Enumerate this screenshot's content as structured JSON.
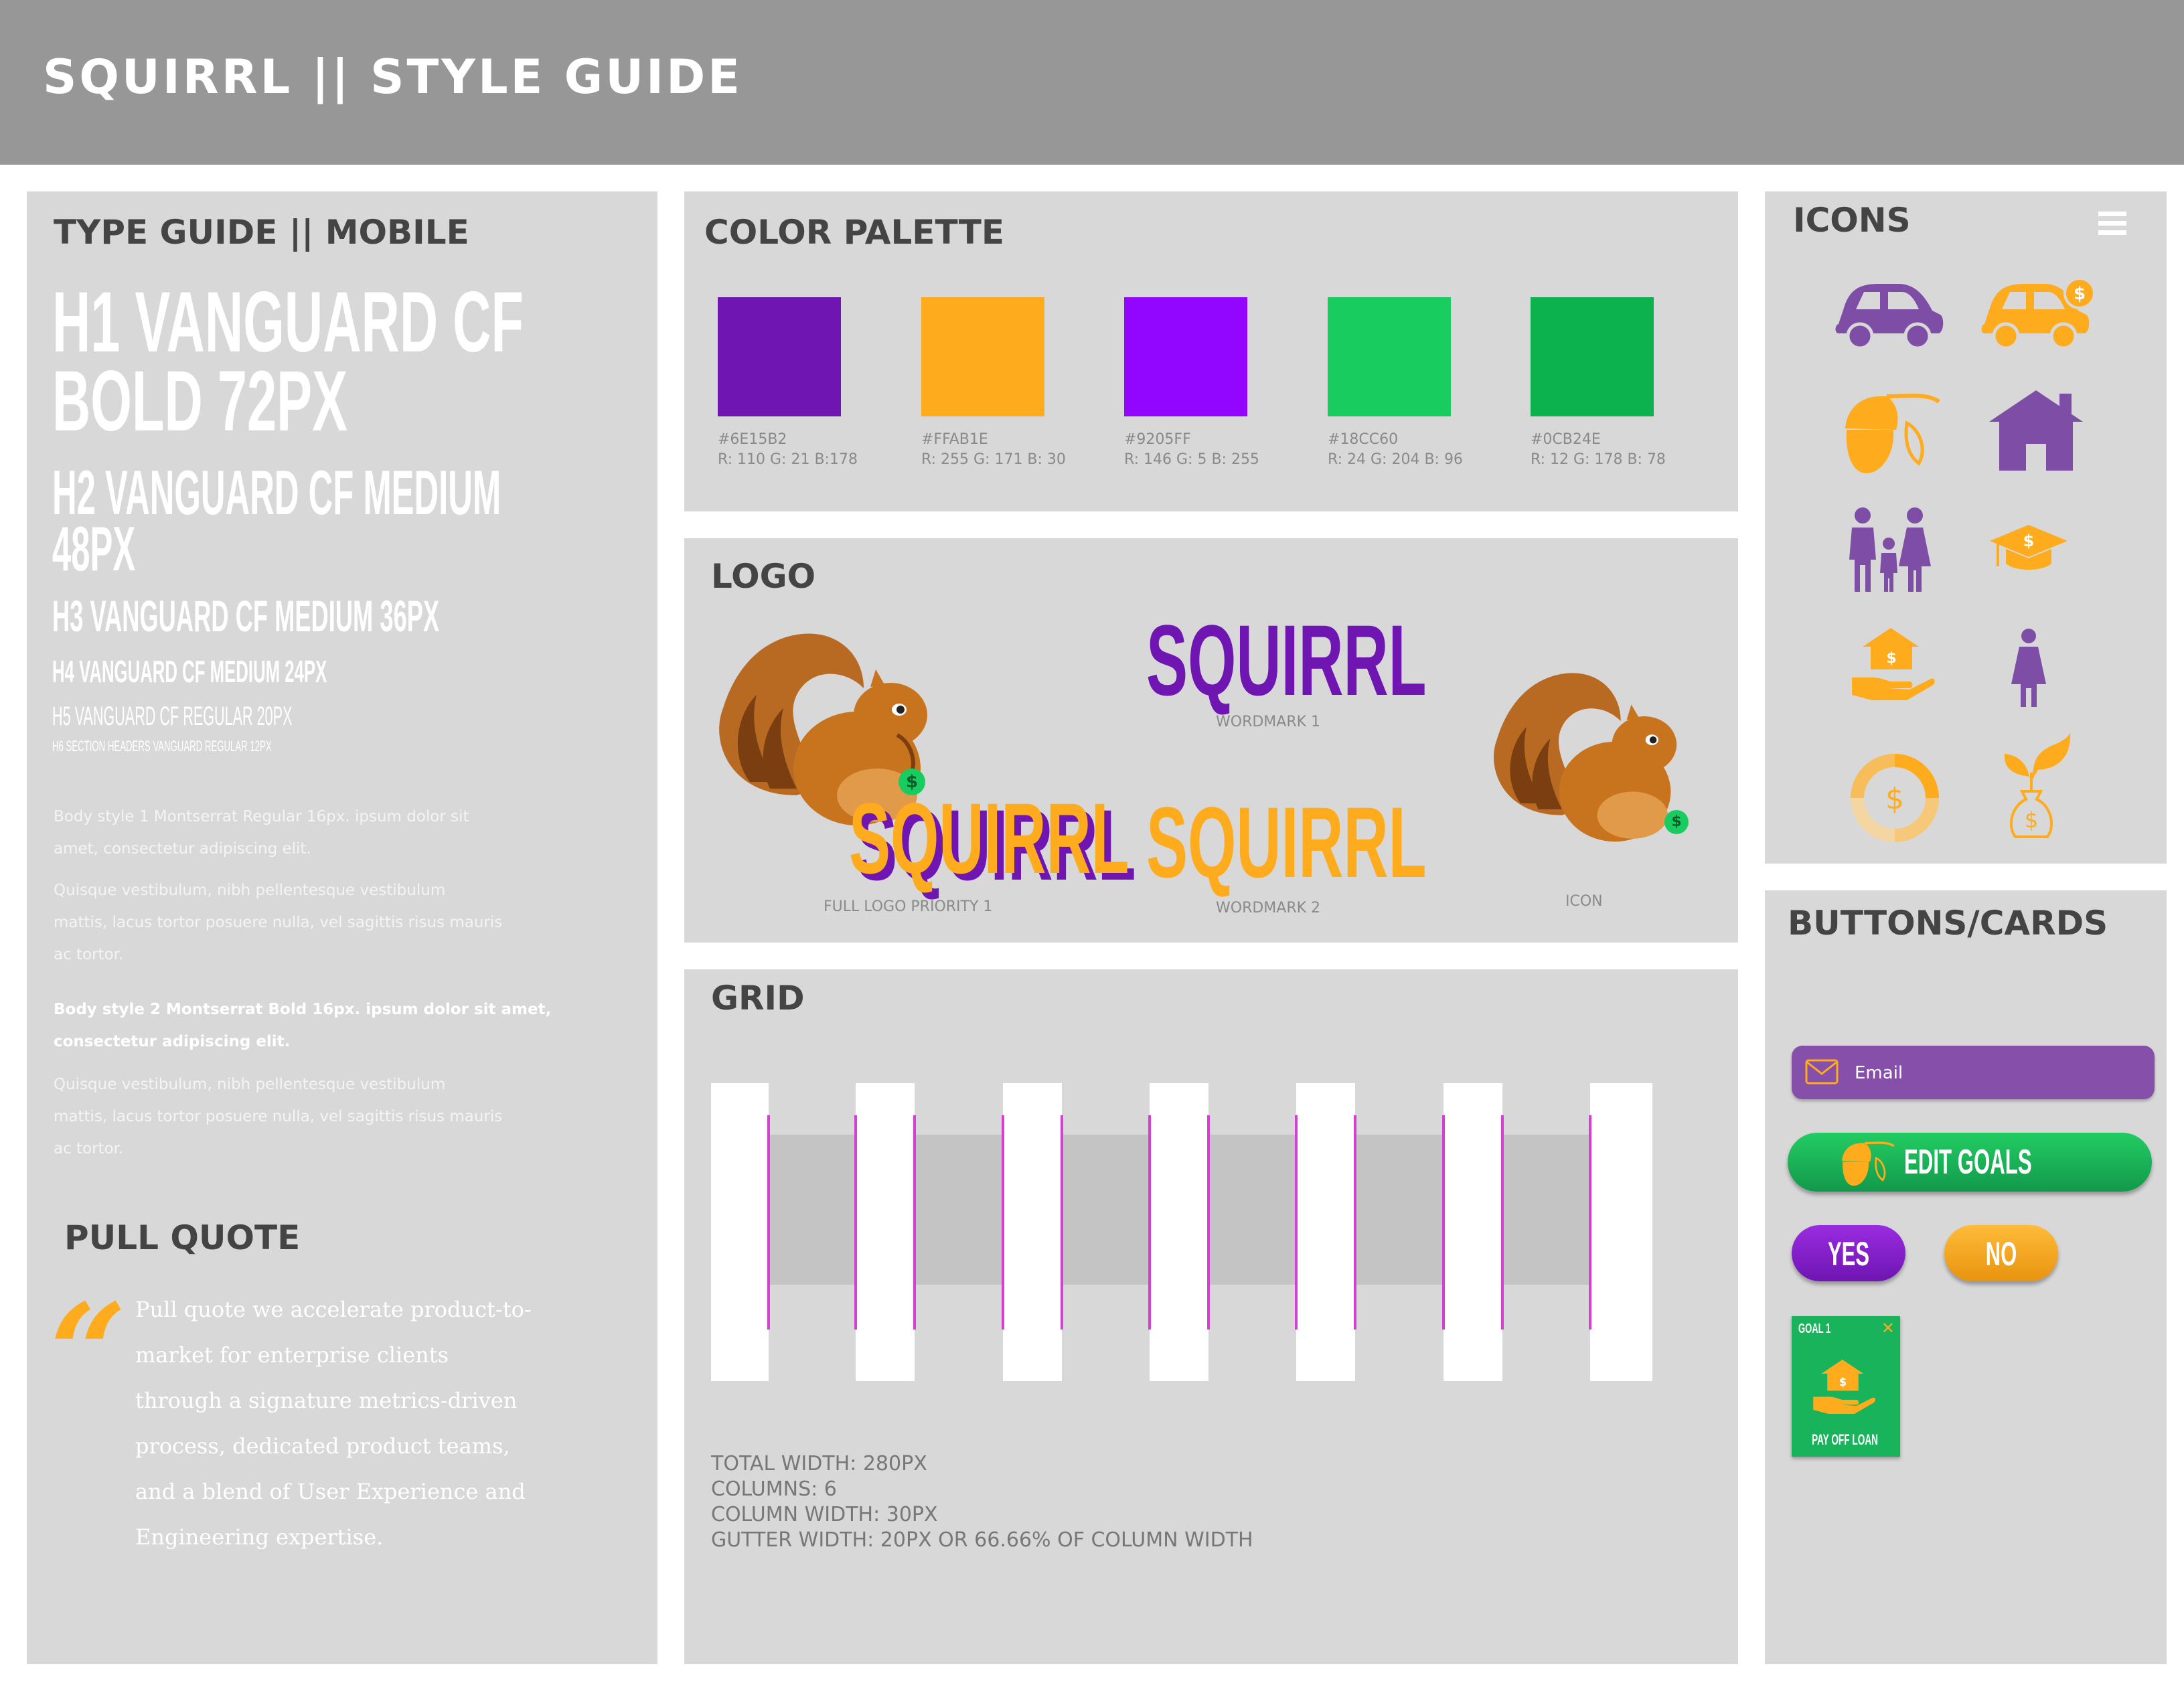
{
  "header": {
    "title": "SQUIRRL || STYLE GUIDE"
  },
  "type_guide": {
    "title": "TYPE GUIDE || MOBILE",
    "h1_line1": "H1 VANGUARD CF",
    "h1_line2": "BOLD 72PX",
    "h2_line1": "H2 VANGUARD CF MEDIUM",
    "h2_line2": "48PX",
    "h3": "H3 VANGUARD CF MEDIUM 36PX",
    "h4": "H4 VANGUARD CF MEDIUM 24PX",
    "h5": "H5 VANGUARD CF REGULAR 20PX",
    "h6": "H6 SECTION HEADERS VANGUARD REGULAR 12PX",
    "body1_a_l1": "Body style 1 Montserrat Regular 16px. ipsum dolor sit",
    "body1_a_l2": "amet, consectetur adipiscing elit.",
    "body1_b_l1": "Quisque vestibulum, nibh pellentesque vestibulum",
    "body1_b_l2": "mattis, lacus tortor posuere nulla, vel sagittis risus mauris",
    "body1_b_l3": "ac tortor.",
    "body2_a_l1": "Body style 2 Montserrat Bold 16px. ipsum dolor sit amet,",
    "body2_a_l2": "consectetur adipiscing elit.",
    "body2_b_l1": "Quisque vestibulum, nibh pellentesque vestibulum",
    "body2_b_l2": "mattis, lacus tortor posuere nulla, vel sagittis risus mauris",
    "body2_b_l3": "ac tortor."
  },
  "pull_quote": {
    "title": "PULL QUOTE",
    "mark": "“",
    "lines": [
      "Pull quote we accelerate product-to-",
      "market for enterprise clients",
      "through a signature metrics-driven",
      "process, dedicated product teams,",
      "and a blend of User Experience and",
      "Engineering expertise."
    ]
  },
  "palette": {
    "title": "COLOR PALETTE",
    "colors": [
      {
        "hex": "#6E15B2",
        "rgb": "R: 110 G: 21 B:178",
        "swatch": "#6e15b2"
      },
      {
        "hex": "#FFAB1E",
        "rgb": "R: 255 G: 171 B: 30",
        "swatch": "#ffab1e"
      },
      {
        "hex": "#9205FF",
        "rgb": "R: 146 G: 5 B: 255",
        "swatch": "#9205ff"
      },
      {
        "hex": "#18CC60",
        "rgb": "R: 24 G: 204 B: 96",
        "swatch": "#18cc60"
      },
      {
        "hex": "#0CB24E",
        "rgb": "R: 12 G: 178 B: 78",
        "swatch": "#0cb24e"
      }
    ]
  },
  "logo": {
    "title": "LOGO",
    "wordmark_text": "SQUIRRL",
    "full_logo_caption": "FULL LOGO PRIORITY 1",
    "wordmark1_caption": "WORDMARK 1",
    "wordmark2_caption": "WORDMARK 2",
    "icon_caption": "ICON",
    "dollar": "$"
  },
  "grid": {
    "title": "GRID",
    "total_width": "TOTAL WIDTH: 280PX",
    "columns": "COLUMNS: 6",
    "column_width": "COLUMN WIDTH: 30PX",
    "gutter_width": "GUTTER WIDTH: 20PX OR 66.66% OF COLUMN WIDTH"
  },
  "icons": {
    "title": "ICONS",
    "names": [
      "car-icon",
      "car-savings-icon",
      "acorn-icon",
      "home-icon",
      "family-icon",
      "graduation-icon",
      "home-savings-icon",
      "person-icon",
      "savings-progress-icon",
      "money-growth-icon"
    ],
    "dollar": "$"
  },
  "buttons": {
    "title": "BUTTONS/CARDS",
    "email_label": "Email",
    "edit_goals": "EDIT GOALS",
    "yes": "YES",
    "no": "NO",
    "card_goal": "GOAL 1",
    "card_close": "✕",
    "card_label": "PAY OFF LOAN",
    "dollar": "$"
  },
  "colors": {
    "purple": "#6E15B2",
    "orange": "#FFAB1E",
    "violet": "#9205FF",
    "green": "#18CC60",
    "dark_green": "#0CB24E",
    "icon_purple": "#7e4ea6"
  }
}
